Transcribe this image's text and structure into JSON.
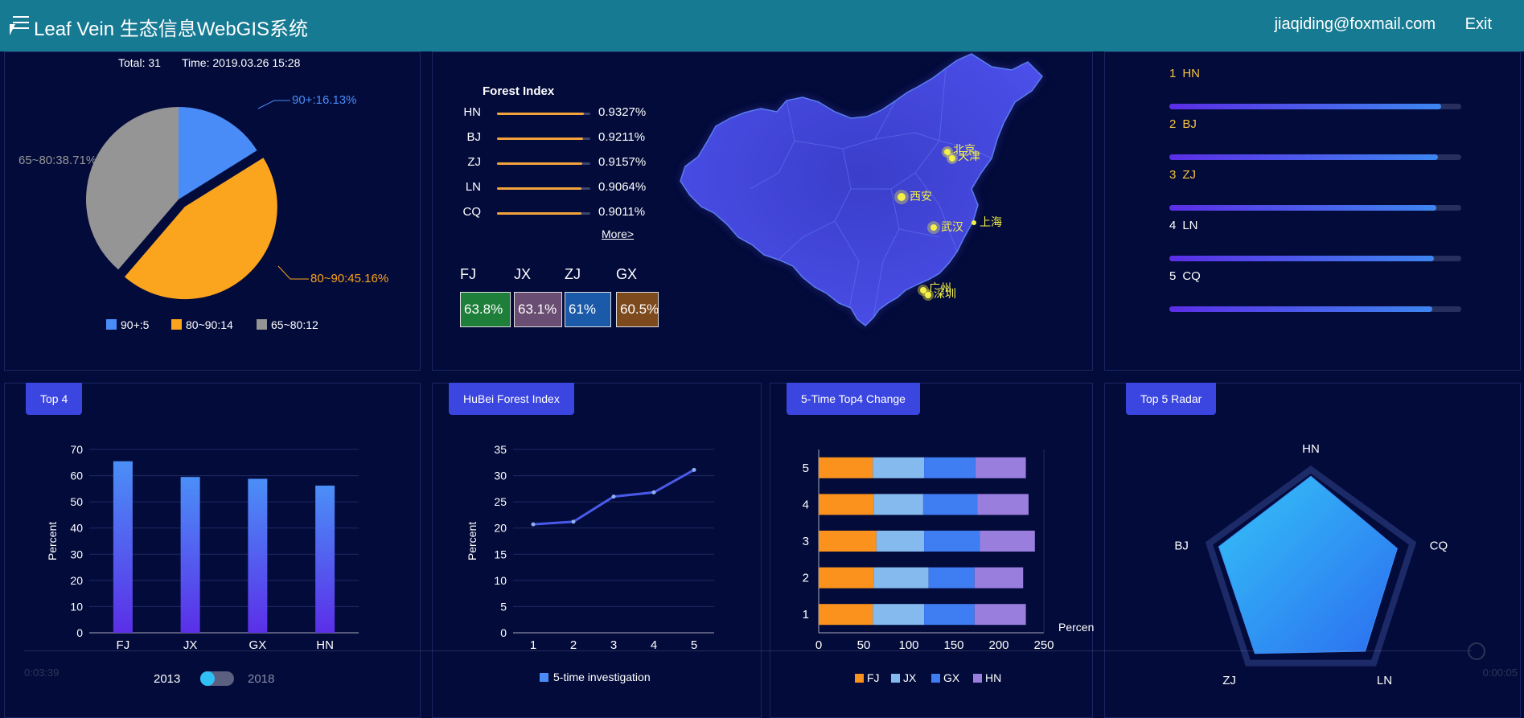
{
  "header": {
    "title": "Leaf Vein 生态信息WebGIS系统",
    "user_email": "jiaqiding@foxmail.com",
    "exit_label": "Exit"
  },
  "pie_panel": {
    "total_label": "Total: 31",
    "time_label": "Time: 2019.03.26 15:28",
    "slice_labels": [
      "90+:16.13%",
      "80~90:45.16%",
      "65~80:38.71%"
    ],
    "legend": [
      "90+:5",
      "80~90:14",
      "65~80:12"
    ],
    "colors": [
      "#4a8cf7",
      "#fba41e",
      "#959595"
    ]
  },
  "forest_index": {
    "title": "Forest Index",
    "rows": [
      {
        "name": "HN",
        "value": "0.9327%",
        "fraction": 0.9327
      },
      {
        "name": "BJ",
        "value": "0.9211%",
        "fraction": 0.9211
      },
      {
        "name": "ZJ",
        "value": "0.9157%",
        "fraction": 0.9157
      },
      {
        "name": "LN",
        "value": "0.9064%",
        "fraction": 0.9064
      },
      {
        "name": "CQ",
        "value": "0.9011%",
        "fraction": 0.9011
      }
    ],
    "more_label": "More>",
    "provinces": [
      {
        "name": "FJ",
        "value": "63.8%",
        "color": "#1e7f3a"
      },
      {
        "name": "JX",
        "value": "63.1%",
        "color": "#6a4d72"
      },
      {
        "name": "ZJ",
        "value": "61%",
        "color": "#1a5aa8"
      },
      {
        "name": "GX",
        "value": "60.5%",
        "color": "#7d4a1e"
      }
    ]
  },
  "map": {
    "cities": [
      "北京",
      "天津",
      "西安",
      "武汉",
      "上海",
      "广州",
      "深圳"
    ]
  },
  "ranking": {
    "items": [
      {
        "rank": "1",
        "name": "HN",
        "fraction": 0.93
      },
      {
        "rank": "2",
        "name": "BJ",
        "fraction": 0.92
      },
      {
        "rank": "3",
        "name": "ZJ",
        "fraction": 0.915
      },
      {
        "rank": "4",
        "name": "LN",
        "fraction": 0.906
      },
      {
        "rank": "5",
        "name": "CQ",
        "fraction": 0.9
      }
    ]
  },
  "top4": {
    "tab_label": "Top 4",
    "toggle_from": "2013",
    "toggle_to": "2018"
  },
  "hubei": {
    "tab_label": "HuBei Forest Index",
    "legend": "5-time investigation"
  },
  "five_time": {
    "tab_label": "5-Time Top4 Change"
  },
  "radar": {
    "tab_label": "Top 5 Radar"
  },
  "video": {
    "elapsed": "0:03:39",
    "remaining": "0:00:05"
  },
  "chart_data": [
    {
      "type": "pie",
      "categories": [
        "90+",
        "80~90",
        "65~80"
      ],
      "values": [
        5,
        14,
        12
      ],
      "percentages": [
        16.13,
        45.16,
        38.71
      ]
    },
    {
      "type": "bar",
      "categories": [
        "FJ",
        "JX",
        "GX",
        "HN"
      ],
      "values": [
        65.5,
        59.5,
        58.8,
        56.2
      ],
      "ylabel": "Percent",
      "ylim": [
        0,
        70
      ],
      "yticks": [
        0,
        10,
        20,
        30,
        40,
        50,
        60,
        70
      ]
    },
    {
      "type": "line",
      "x": [
        1,
        2,
        3,
        4,
        5
      ],
      "series": [
        {
          "name": "5-time investigation",
          "values": [
            20.7,
            21.2,
            26.0,
            26.8,
            31.1
          ]
        }
      ],
      "ylabel": "Percent",
      "ylim": [
        0,
        35
      ],
      "yticks": [
        0,
        5,
        10,
        15,
        20,
        25,
        30,
        35
      ]
    },
    {
      "type": "bar",
      "orientation": "horizontal",
      "stacked": true,
      "categories": [
        "1",
        "2",
        "3",
        "4",
        "5"
      ],
      "series": [
        {
          "name": "FJ",
          "values": [
            60,
            61,
            64,
            61,
            60
          ],
          "color": "#fb921e"
        },
        {
          "name": "JX",
          "values": [
            57,
            61,
            53,
            55,
            57
          ],
          "color": "#85baee"
        },
        {
          "name": "GX",
          "values": [
            56,
            51,
            62,
            60,
            57
          ],
          "color": "#3f7df2"
        },
        {
          "name": "HN",
          "values": [
            57,
            54,
            61,
            57,
            56
          ],
          "color": "#9a7ede"
        }
      ],
      "xlabel": "Percent",
      "xlim": [
        0,
        250
      ],
      "xticks": [
        0,
        50,
        100,
        150,
        200,
        250
      ]
    },
    {
      "type": "radar",
      "categories": [
        "HN",
        "CQ",
        "LN",
        "ZJ",
        "BJ"
      ],
      "values": [
        0.9327,
        0.9011,
        0.9064,
        0.9157,
        0.9211
      ]
    }
  ]
}
